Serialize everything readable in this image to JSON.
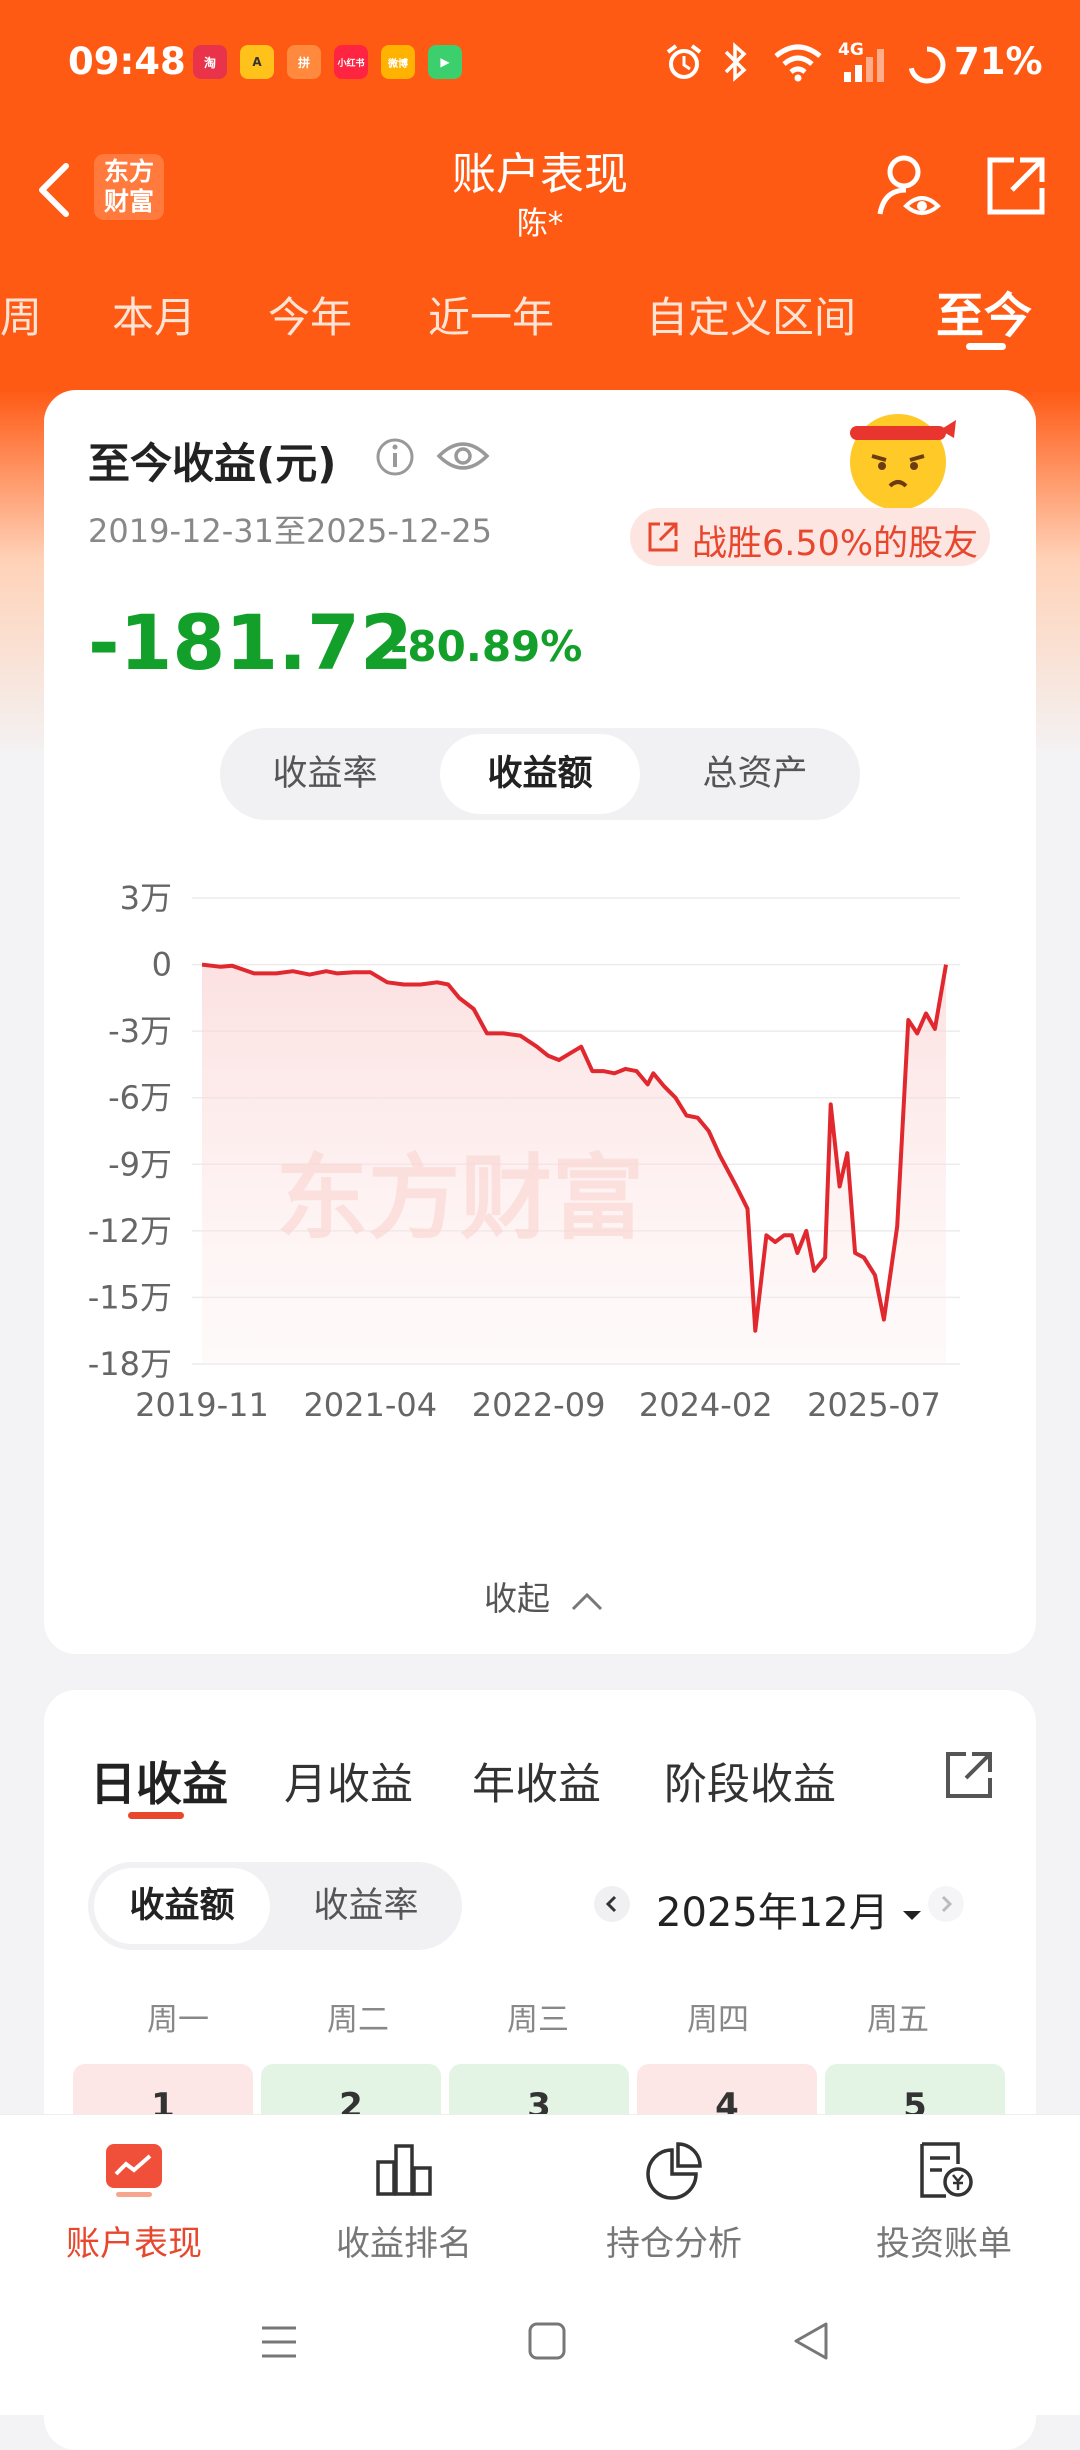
{
  "status_bar": {
    "time": "09:48",
    "battery": "71%",
    "network": "4G",
    "app_icons": [
      "淘",
      "A",
      "拼",
      "小红书",
      "微博",
      "▶"
    ]
  },
  "header": {
    "back_icon": "back-icon",
    "logo_text_line1": "东方",
    "logo_text_line2": "财富",
    "title": "账户表现",
    "subtitle": "陈*"
  },
  "period_tabs": [
    {
      "label": "周",
      "active": false
    },
    {
      "label": "本月",
      "active": false
    },
    {
      "label": "今年",
      "active": false
    },
    {
      "label": "近一年",
      "active": false
    },
    {
      "label": "自定义区间",
      "active": false
    },
    {
      "label": "至今",
      "active": true
    }
  ],
  "summary": {
    "label": "至今收益(元)",
    "date_range": "2019-12-31至2025-12-25",
    "amount": "-181.72",
    "percent": "-80.89%",
    "beat_text": "战胜6.50%的股友",
    "amount_color": "#12a02a"
  },
  "chart_toggle": {
    "options": [
      "收益率",
      "收益额",
      "总资产"
    ],
    "active_index": 1
  },
  "chart_data": {
    "type": "area",
    "watermark": "东方财富",
    "ylabel": "",
    "xlabel": "",
    "y_tick_labels": [
      "3万",
      "0",
      "-3万",
      "-6万",
      "-9万",
      "-12万",
      "-15万",
      "-18万"
    ],
    "y_ticks": [
      30000,
      0,
      -30000,
      -60000,
      -90000,
      -120000,
      -150000,
      -180000
    ],
    "ylim": [
      -180000,
      30000
    ],
    "x_tick_labels": [
      "2019-11",
      "2021-04",
      "2022-09",
      "2024-02",
      "2025-07"
    ],
    "x_ticks": [
      2019.83,
      2021.25,
      2022.67,
      2024.08,
      2025.5
    ],
    "xlim": [
      2019.83,
      2025.98
    ],
    "grid": true,
    "series": [
      {
        "color": "#e0282e",
        "points": [
          [
            2019.83,
            0
          ],
          [
            2020.0,
            -1000
          ],
          [
            2020.1,
            -500
          ],
          [
            2020.3,
            -4000
          ],
          [
            2020.5,
            -4000
          ],
          [
            2020.65,
            -3000
          ],
          [
            2020.8,
            -4500
          ],
          [
            2020.95,
            -3000
          ],
          [
            2021.05,
            -4000
          ],
          [
            2021.2,
            -3500
          ],
          [
            2021.35,
            -3500
          ],
          [
            2021.5,
            -8000
          ],
          [
            2021.65,
            -9000
          ],
          [
            2021.8,
            -9000
          ],
          [
            2021.95,
            -8000
          ],
          [
            2022.05,
            -9000
          ],
          [
            2022.15,
            -15000
          ],
          [
            2022.28,
            -20000
          ],
          [
            2022.4,
            -31000
          ],
          [
            2022.55,
            -31000
          ],
          [
            2022.7,
            -32000
          ],
          [
            2022.85,
            -37000
          ],
          [
            2022.95,
            -41000
          ],
          [
            2023.05,
            -43000
          ],
          [
            2023.15,
            -40000
          ],
          [
            2023.25,
            -37000
          ],
          [
            2023.35,
            -48000
          ],
          [
            2023.45,
            -48000
          ],
          [
            2023.55,
            -49000
          ],
          [
            2023.65,
            -47000
          ],
          [
            2023.75,
            -48000
          ],
          [
            2023.85,
            -54000
          ],
          [
            2023.9,
            -49000
          ],
          [
            2024.0,
            -55000
          ],
          [
            2024.1,
            -60000
          ],
          [
            2024.2,
            -68000
          ],
          [
            2024.3,
            -69000
          ],
          [
            2024.4,
            -75000
          ],
          [
            2024.5,
            -86000
          ],
          [
            2024.65,
            -100000
          ],
          [
            2024.75,
            -110000
          ],
          [
            2024.82,
            -165000
          ],
          [
            2024.92,
            -122000
          ],
          [
            2025.0,
            -125000
          ],
          [
            2025.08,
            -122000
          ],
          [
            2025.15,
            -122000
          ],
          [
            2025.2,
            -130000
          ],
          [
            2025.28,
            -120000
          ],
          [
            2025.35,
            -138000
          ],
          [
            2025.45,
            -132000
          ],
          [
            2025.5,
            -63000
          ],
          [
            2025.58,
            -100000
          ],
          [
            2025.65,
            -85000
          ],
          [
            2025.72,
            -130000
          ],
          [
            2025.8,
            -132000
          ],
          [
            2025.9,
            -140000
          ],
          [
            2025.98,
            -160000
          ],
          [
            2026.1,
            -118000
          ],
          [
            2026.2,
            -25000
          ],
          [
            2026.28,
            -31000
          ],
          [
            2026.36,
            -22000
          ],
          [
            2026.44,
            -29000
          ],
          [
            2026.54,
            0
          ]
        ]
      }
    ]
  },
  "collapse": {
    "label": "收起"
  },
  "daily_section": {
    "tabs": [
      "日收益",
      "月收益",
      "年收益",
      "阶段收益"
    ],
    "active_index": 0,
    "toggle": [
      "收益额",
      "收益率"
    ],
    "toggle_active_index": 0,
    "month": "2025年12月",
    "weekdays": [
      "周一",
      "周二",
      "周三",
      "周四",
      "周五"
    ],
    "days": [
      {
        "day": "1",
        "color": "#fde6e6"
      },
      {
        "day": "2",
        "color": "#e3f4e5"
      },
      {
        "day": "3",
        "color": "#e3f4e5"
      },
      {
        "day": "4",
        "color": "#fde6e6"
      },
      {
        "day": "5",
        "color": "#e3f4e5"
      }
    ]
  },
  "bottom_nav": [
    {
      "label": "账户表现",
      "icon": "account-performance-icon",
      "active": true
    },
    {
      "label": "收益排名",
      "icon": "ranking-bar-icon",
      "active": false
    },
    {
      "label": "持仓分析",
      "icon": "pie-chart-icon",
      "active": false
    },
    {
      "label": "投资账单",
      "icon": "bill-icon",
      "active": false
    }
  ]
}
